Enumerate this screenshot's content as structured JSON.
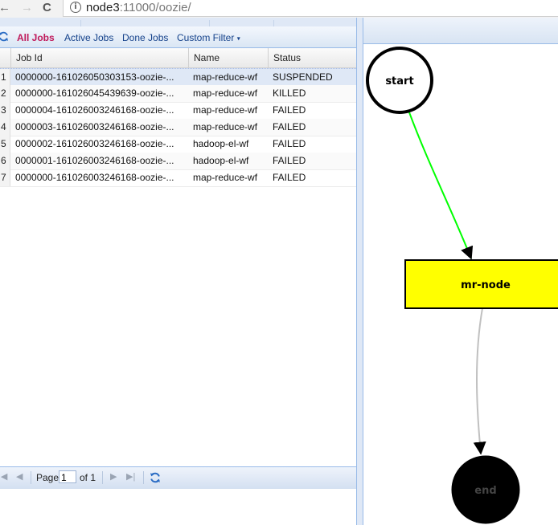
{
  "browser": {
    "back_icon": "←",
    "forward_icon": "→",
    "reload_icon": "C",
    "info_icon": "i",
    "url_host": "node3",
    "url_rest": ":11000/oozie/"
  },
  "toolbar": {
    "refresh_icon": "refresh-icon",
    "all_jobs": "All Jobs",
    "active_jobs": "Active Jobs",
    "done_jobs": "Done Jobs",
    "custom_filter": "Custom Filter",
    "custom_filter_caret": "▾"
  },
  "grid": {
    "columns": [
      "Job Id",
      "Name",
      "Status"
    ],
    "rows": [
      {
        "num": "1",
        "job_id": "0000000-161026050303153-oozie-...",
        "name": "map-reduce-wf",
        "status": "SUSPENDED"
      },
      {
        "num": "2",
        "job_id": "0000000-161026045439639-oozie-...",
        "name": "map-reduce-wf",
        "status": "KILLED"
      },
      {
        "num": "3",
        "job_id": "0000004-161026003246168-oozie-...",
        "name": "map-reduce-wf",
        "status": "FAILED"
      },
      {
        "num": "4",
        "job_id": "0000003-161026003246168-oozie-...",
        "name": "map-reduce-wf",
        "status": "FAILED"
      },
      {
        "num": "5",
        "job_id": "0000002-161026003246168-oozie-...",
        "name": "hadoop-el-wf",
        "status": "FAILED"
      },
      {
        "num": "6",
        "job_id": "0000001-161026003246168-oozie-...",
        "name": "hadoop-el-wf",
        "status": "FAILED"
      },
      {
        "num": "7",
        "job_id": "0000000-161026003246168-oozie-...",
        "name": "map-reduce-wf",
        "status": "FAILED"
      }
    ]
  },
  "paging": {
    "first_icon": "|◀",
    "prev_icon": "◀",
    "page_label": "Page",
    "page_value": "1",
    "of_label": "of 1",
    "next_icon": "▶",
    "last_icon": "▶|",
    "refresh_icon": "refresh-icon"
  },
  "graph": {
    "nodes": {
      "start": "start",
      "mr": "mr-node",
      "end": "end"
    },
    "colors": {
      "start_fill": "#ffffff",
      "mr_fill": "#ffff00",
      "end_fill": "#000000",
      "start_edge": "#00ff00",
      "end_edge": "#c0c0c0"
    }
  }
}
